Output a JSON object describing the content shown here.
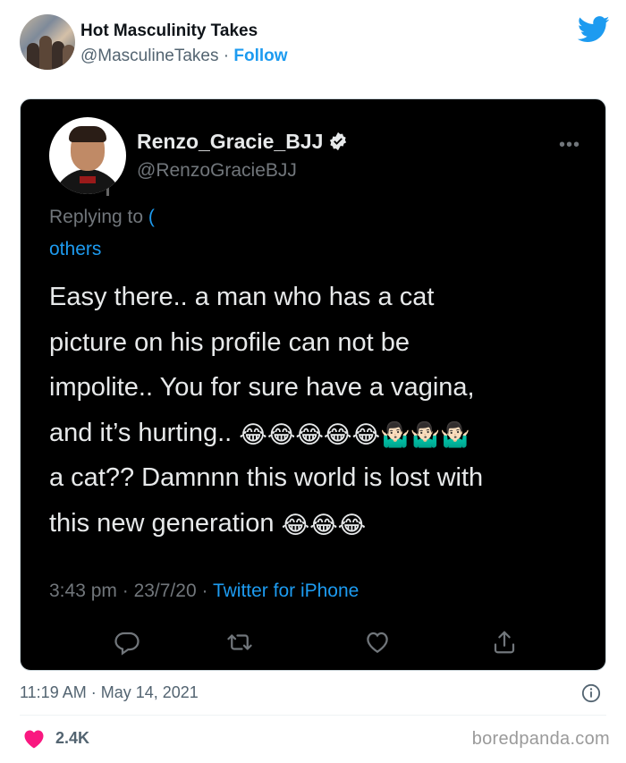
{
  "embed": {
    "author_name": "Hot Masculinity Takes",
    "author_handle": "@MasculineTakes",
    "separator": " · ",
    "follow_label": "Follow",
    "brand_icon": "twitter-bird-icon",
    "brand_color": "#1d9bf0"
  },
  "screenshot": {
    "display_name": "Renzo_Gracie_BJJ",
    "verified": true,
    "handle": "@RenzoGracieBJJ",
    "replying_prefix": "Replying to ",
    "replying_mention": "(",
    "replying_others": "others",
    "text_lines": [
      "Easy there.. a man who has a cat",
      "picture on his profile can not be",
      "impolite.. You for sure have a vagina,",
      "and it’s hurting..",
      "a cat?? Damnnn this world is lost with",
      "this new generation"
    ],
    "emoji_line4": "😂😂😂😂😂🤷🏻‍♂️🤷🏻‍♂️🤷🏻‍♂️",
    "emoji_line6": "😂😂😂",
    "time": "3:43 pm",
    "date": "23/7/20",
    "source": "Twitter for iPhone",
    "background": "#000000",
    "actions": [
      "reply-icon",
      "retweet-icon",
      "like-icon",
      "share-icon"
    ]
  },
  "footer": {
    "timestamp": "11:19 AM · May 14, 2021",
    "like_count": "2.4K",
    "like_color": "#f91880",
    "watermark": "boredpanda.com"
  }
}
